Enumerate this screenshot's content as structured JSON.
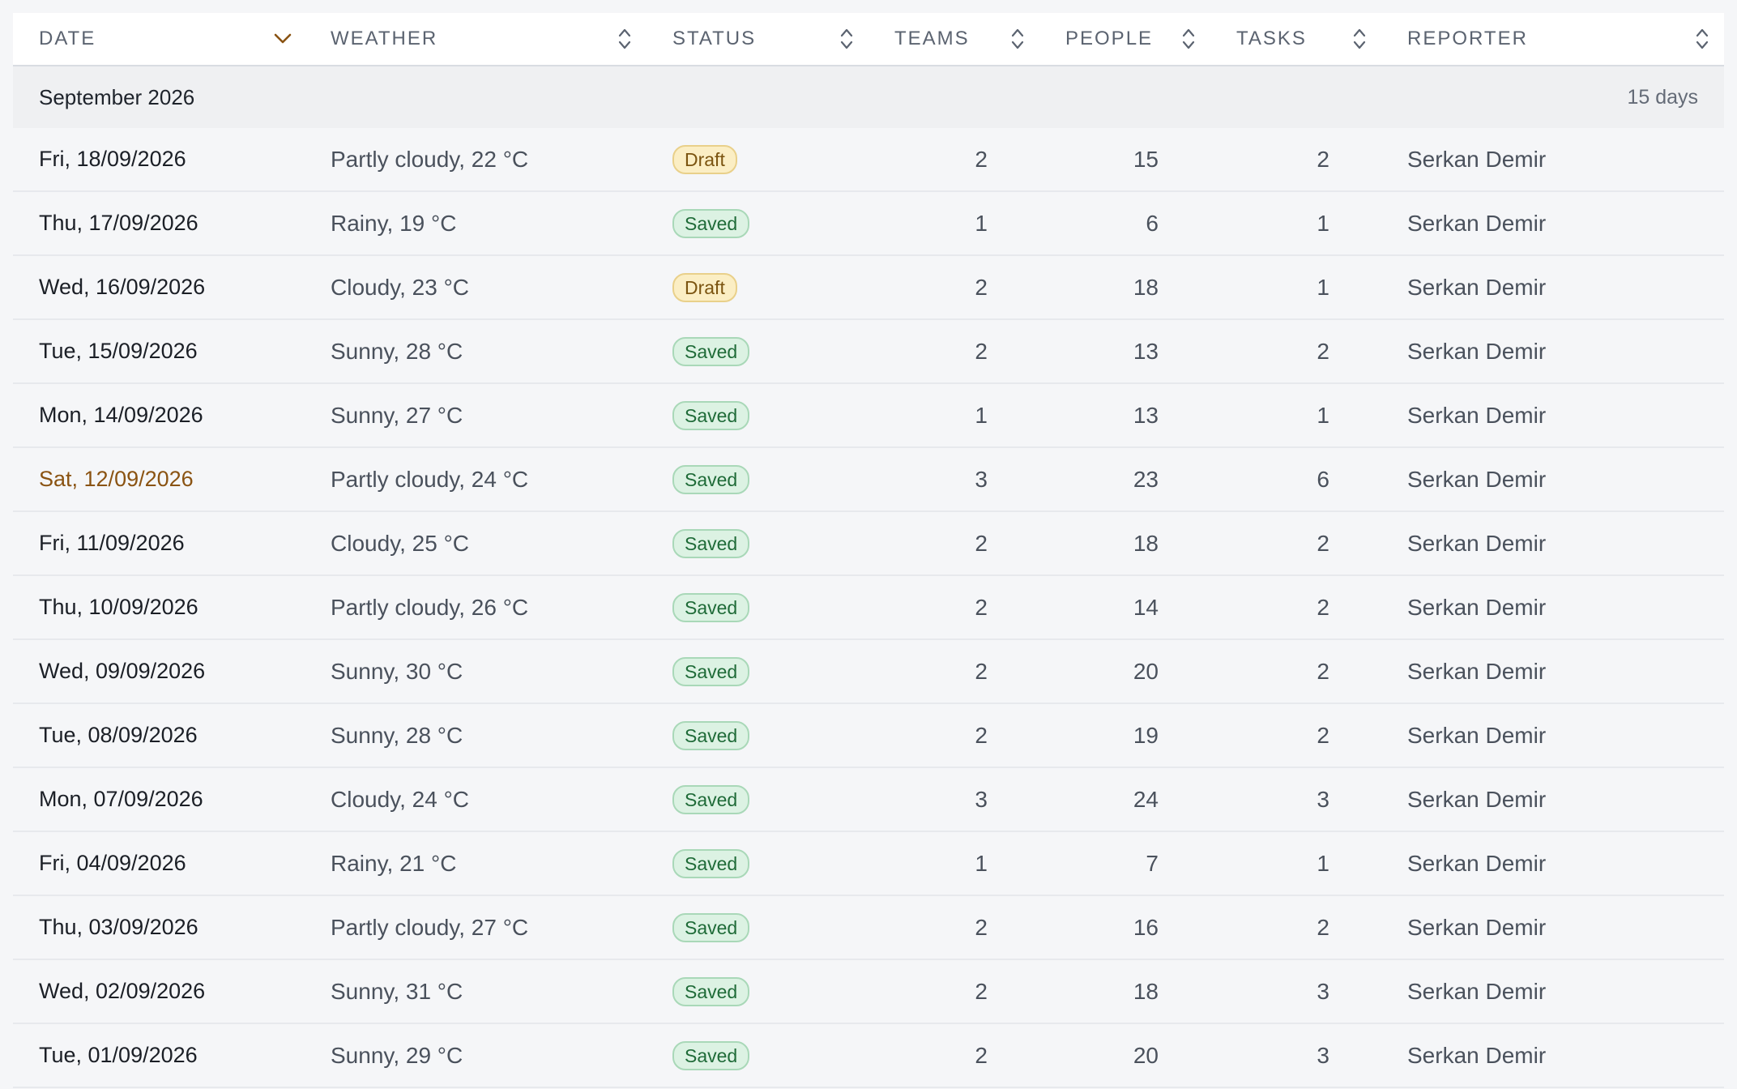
{
  "table": {
    "columns": [
      {
        "key": "date",
        "label": "DATE",
        "sort": "desc"
      },
      {
        "key": "weather",
        "label": "WEATHER",
        "sort": "none"
      },
      {
        "key": "status",
        "label": "STATUS",
        "sort": "none"
      },
      {
        "key": "teams",
        "label": "TEAMS",
        "sort": "none"
      },
      {
        "key": "people",
        "label": "PEOPLE",
        "sort": "none"
      },
      {
        "key": "tasks",
        "label": "TASKS",
        "sort": "none"
      },
      {
        "key": "reporter",
        "label": "REPORTER",
        "sort": "none"
      }
    ],
    "group": {
      "title": "September 2026",
      "count": "15 days"
    },
    "rows": [
      {
        "date": "Fri, 18/09/2026",
        "weekend": false,
        "weather": "Partly cloudy, 22 °C",
        "status": "Draft",
        "status_kind": "draft",
        "teams": "2",
        "people": "15",
        "tasks": "2",
        "reporter": "Serkan Demir"
      },
      {
        "date": "Thu, 17/09/2026",
        "weekend": false,
        "weather": "Rainy, 19 °C",
        "status": "Saved",
        "status_kind": "saved",
        "teams": "1",
        "people": "6",
        "tasks": "1",
        "reporter": "Serkan Demir"
      },
      {
        "date": "Wed, 16/09/2026",
        "weekend": false,
        "weather": "Cloudy, 23 °C",
        "status": "Draft",
        "status_kind": "draft",
        "teams": "2",
        "people": "18",
        "tasks": "1",
        "reporter": "Serkan Demir"
      },
      {
        "date": "Tue, 15/09/2026",
        "weekend": false,
        "weather": "Sunny, 28 °C",
        "status": "Saved",
        "status_kind": "saved",
        "teams": "2",
        "people": "13",
        "tasks": "2",
        "reporter": "Serkan Demir"
      },
      {
        "date": "Mon, 14/09/2026",
        "weekend": false,
        "weather": "Sunny, 27 °C",
        "status": "Saved",
        "status_kind": "saved",
        "teams": "1",
        "people": "13",
        "tasks": "1",
        "reporter": "Serkan Demir"
      },
      {
        "date": "Sat, 12/09/2026",
        "weekend": true,
        "weather": "Partly cloudy, 24 °C",
        "status": "Saved",
        "status_kind": "saved",
        "teams": "3",
        "people": "23",
        "tasks": "6",
        "reporter": "Serkan Demir"
      },
      {
        "date": "Fri, 11/09/2026",
        "weekend": false,
        "weather": "Cloudy, 25 °C",
        "status": "Saved",
        "status_kind": "saved",
        "teams": "2",
        "people": "18",
        "tasks": "2",
        "reporter": "Serkan Demir"
      },
      {
        "date": "Thu, 10/09/2026",
        "weekend": false,
        "weather": "Partly cloudy, 26 °C",
        "status": "Saved",
        "status_kind": "saved",
        "teams": "2",
        "people": "14",
        "tasks": "2",
        "reporter": "Serkan Demir"
      },
      {
        "date": "Wed, 09/09/2026",
        "weekend": false,
        "weather": "Sunny, 30 °C",
        "status": "Saved",
        "status_kind": "saved",
        "teams": "2",
        "people": "20",
        "tasks": "2",
        "reporter": "Serkan Demir"
      },
      {
        "date": "Tue, 08/09/2026",
        "weekend": false,
        "weather": "Sunny, 28 °C",
        "status": "Saved",
        "status_kind": "saved",
        "teams": "2",
        "people": "19",
        "tasks": "2",
        "reporter": "Serkan Demir"
      },
      {
        "date": "Mon, 07/09/2026",
        "weekend": false,
        "weather": "Cloudy, 24 °C",
        "status": "Saved",
        "status_kind": "saved",
        "teams": "3",
        "people": "24",
        "tasks": "3",
        "reporter": "Serkan Demir"
      },
      {
        "date": "Fri, 04/09/2026",
        "weekend": false,
        "weather": "Rainy, 21 °C",
        "status": "Saved",
        "status_kind": "saved",
        "teams": "1",
        "people": "7",
        "tasks": "1",
        "reporter": "Serkan Demir"
      },
      {
        "date": "Thu, 03/09/2026",
        "weekend": false,
        "weather": "Partly cloudy, 27 °C",
        "status": "Saved",
        "status_kind": "saved",
        "teams": "2",
        "people": "16",
        "tasks": "2",
        "reporter": "Serkan Demir"
      },
      {
        "date": "Wed, 02/09/2026",
        "weekend": false,
        "weather": "Sunny, 31 °C",
        "status": "Saved",
        "status_kind": "saved",
        "teams": "2",
        "people": "18",
        "tasks": "3",
        "reporter": "Serkan Demir"
      },
      {
        "date": "Tue, 01/09/2026",
        "weekend": false,
        "weather": "Sunny, 29 °C",
        "status": "Saved",
        "status_kind": "saved",
        "teams": "2",
        "people": "20",
        "tasks": "3",
        "reporter": "Serkan Demir"
      }
    ]
  },
  "colors": {
    "weekend_date": "#8a5312",
    "sort_active": "#8a5312",
    "sort_inactive": "#5b6370",
    "draft_bg": "#fbeec4",
    "saved_bg": "#dcf2e3"
  },
  "icons": {
    "sort_active": "chevron-down-icon",
    "sort_inactive": "sort-updown-icon"
  }
}
